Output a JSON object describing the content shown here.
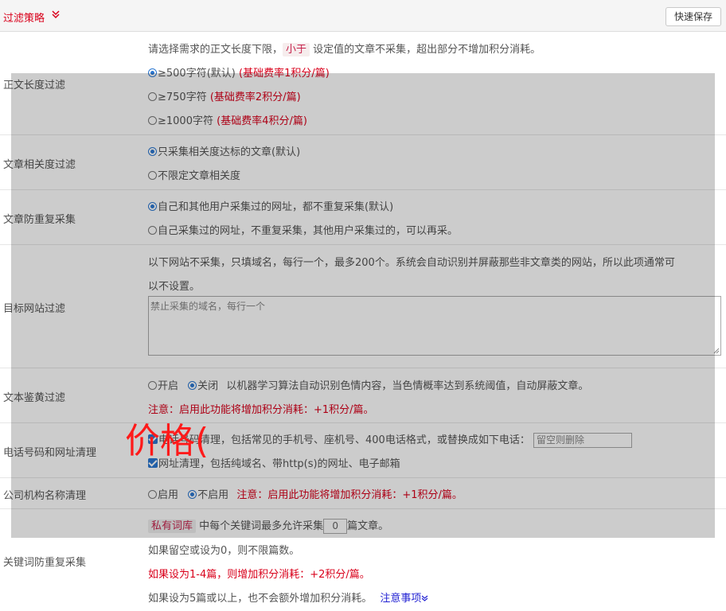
{
  "header": {
    "title": "过滤策略",
    "save_label": "快速保存"
  },
  "length_filter": {
    "label": "正文长度过滤",
    "desc_pre": "请选择需求的正文长度下限，",
    "desc_tag": "小于",
    "desc_post": "设定值的文章不采集，超出部分不增加积分消耗。",
    "options": [
      {
        "text": "≥500字符(默认)",
        "note": "(基础费率1积分/篇)"
      },
      {
        "text": "≥750字符",
        "note": "(基础费率2积分/篇)"
      },
      {
        "text": "≥1000字符",
        "note": "(基础费率4积分/篇)"
      }
    ]
  },
  "relevance_filter": {
    "label": "文章相关度过滤",
    "options": [
      "只采集相关度达标的文章(默认)",
      "不限定文章相关度"
    ]
  },
  "dedupe_filter": {
    "label": "文章防重复采集",
    "options": [
      "自己和其他用户采集过的网址，都不重复采集(默认)",
      "自己采集过的网址，不重复采集，其他用户采集过的，可以再采。"
    ]
  },
  "site_filter": {
    "label": "目标网站过滤",
    "desc_line1": "以下网站不采集，只填域名，每行一个，最多200个。系统会自动识别并屏蔽那些非文章类的网站，所以此项通常可",
    "desc_line2": "以不设置。",
    "placeholder": "禁止采集的域名，每行一个"
  },
  "porn_filter": {
    "label": "文本鉴黄过滤",
    "on": "开启",
    "off": "关闭",
    "desc": "以机器学习算法自动识别色情内容，当色情概率达到系统阈值，自动屏蔽文章。",
    "warning": "注意：启用此功能将增加积分消耗：+1积分/篇。"
  },
  "phone_filter": {
    "label": "电话号码和网址清理",
    "phone_text": "电话号码清理，包括常见的手机号、座机号、400电话格式，或替换成如下电话：",
    "phone_placeholder": "留空则删除",
    "url_text": "网址清理，包括纯域名、带http(s)的网址、电子邮箱"
  },
  "org_filter": {
    "label": "公司机构名称清理",
    "on": "启用",
    "off": "不启用",
    "warning": "注意：启用此功能将增加积分消耗：+1积分/篇。"
  },
  "keyword_dedupe": {
    "label": "关键词防重复采集",
    "tag": "私有词库",
    "pre": "中每个关键词最多允许采集",
    "value": "0",
    "post": "篇文章。",
    "line2": "如果留空或设为0，则不限篇数。",
    "line3": "如果设为1-4篇，则增加积分消耗：+2积分/篇。",
    "line4": "如果设为5篇或以上，也不会额外增加积分消耗。",
    "link": "注意事项"
  },
  "watermark_text": "价格(",
  "colors": {
    "accent_red": "#d9001b",
    "radio_blue": "#2b77d1",
    "link_blue": "#2323d3"
  }
}
